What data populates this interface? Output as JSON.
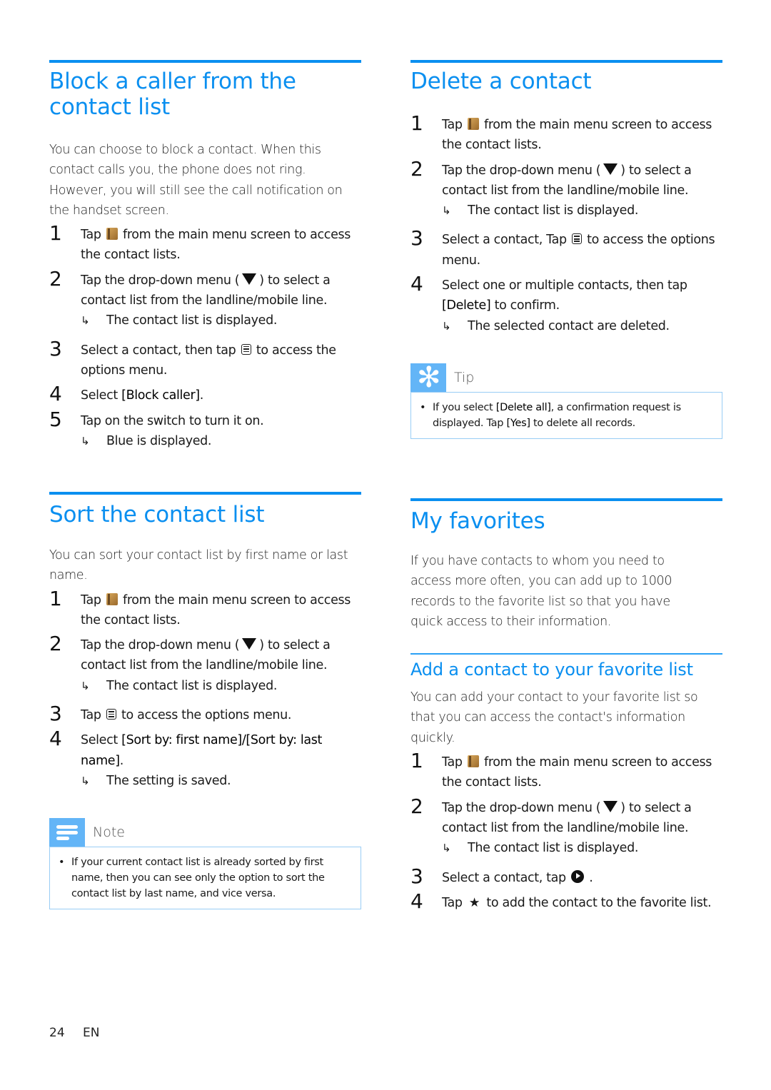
{
  "sections": {
    "block": {
      "title_line1": "Block a caller from the",
      "title_line2": "contact list",
      "intro": "You can choose to block a contact. When this contact calls you, the phone does not ring. However, you will still see the call notification on the handset screen.",
      "steps": [
        {
          "num": "1",
          "pre": "Tap",
          "post": "from the main menu screen to access the contact lists."
        },
        {
          "num": "2",
          "pre": "Tap the drop-down menu (",
          "post": ") to select a contact list from the landline/mobile line.",
          "result": "The contact list is displayed."
        },
        {
          "num": "3",
          "pre": "Select a contact, then tap",
          "post": "to access the options menu."
        },
        {
          "num": "4",
          "pre": "Select",
          "bold": "[Block caller]",
          "post": "."
        },
        {
          "num": "5",
          "text": "Tap on the switch to turn it on.",
          "result": "Blue is displayed."
        }
      ]
    },
    "delete": {
      "title": "Delete a contact",
      "steps": [
        {
          "num": "1",
          "pre": "Tap",
          "post": "from the main menu screen to access the contact lists."
        },
        {
          "num": "2",
          "pre": "Tap the drop-down menu (",
          "post": ") to select a contact list from the landline/mobile line.",
          "result": "The contact list is displayed."
        },
        {
          "num": "3",
          "pre": "Select a contact, Tap",
          "post": "to access the options menu."
        },
        {
          "num": "4",
          "pre": "Select one or multiple contacts, then tap",
          "bold": "[Delete]",
          "post": "to confirm.",
          "result": "The selected contact are deleted."
        }
      ],
      "tip": {
        "label": "Tip",
        "pre": "If you select",
        "bold1": "[Delete all]",
        "mid": ", a confirmation request is displayed. Tap",
        "bold2": "[Yes]",
        "post": "to delete all records."
      }
    },
    "sort": {
      "title": "Sort the contact list",
      "intro": "You can sort your contact list by first name or last name.",
      "steps": [
        {
          "num": "1",
          "pre": "Tap",
          "post": "from the main menu screen to access the contact lists."
        },
        {
          "num": "2",
          "pre": "Tap the drop-down menu (",
          "post": ") to select a contact list from the landline/mobile line.",
          "result": "The contact list is displayed."
        },
        {
          "num": "3",
          "pre": "Tap",
          "post": "to access the options menu."
        },
        {
          "num": "4",
          "pre": "Select",
          "bold": "[Sort by: first name]/[Sort by: last name]",
          "post": ".",
          "result": "The setting is saved."
        }
      ],
      "note": {
        "label": "Note",
        "text": "If your current contact list is already sorted by first name, then you can see only the option to sort the contact list by last name, and vice versa."
      }
    },
    "favorites": {
      "title": "My favorites",
      "intro": "If you have contacts to whom you need to access more often, you can add up to 1000 records to the favorite list so that you have quick access to their information.",
      "sub_title": "Add a contact to your favorite list",
      "sub_intro": "You can add your contact to your favorite list so that you can access the contact's information quickly.",
      "steps": [
        {
          "num": "1",
          "pre": "Tap",
          "post": "from the main menu screen to access the contact lists."
        },
        {
          "num": "2",
          "pre": "Tap the drop-down menu (",
          "post": ") to select a contact list from the landline/mobile line.",
          "result": "The contact list is displayed."
        },
        {
          "num": "3",
          "pre": "Select a contact, tap",
          "post": "."
        },
        {
          "num": "4",
          "pre": "Tap",
          "star": "★",
          "post": "to add the contact to the favorite list."
        }
      ]
    }
  },
  "icons": {
    "result_arrow": "↳",
    "bullet": "•",
    "tip_glyph": "✻"
  },
  "footer": {
    "page_number": "24",
    "language": "EN"
  },
  "colors": {
    "accent": "#0a8ff0",
    "box_badge": "#63b5f7",
    "box_border": "#99cdf5"
  }
}
